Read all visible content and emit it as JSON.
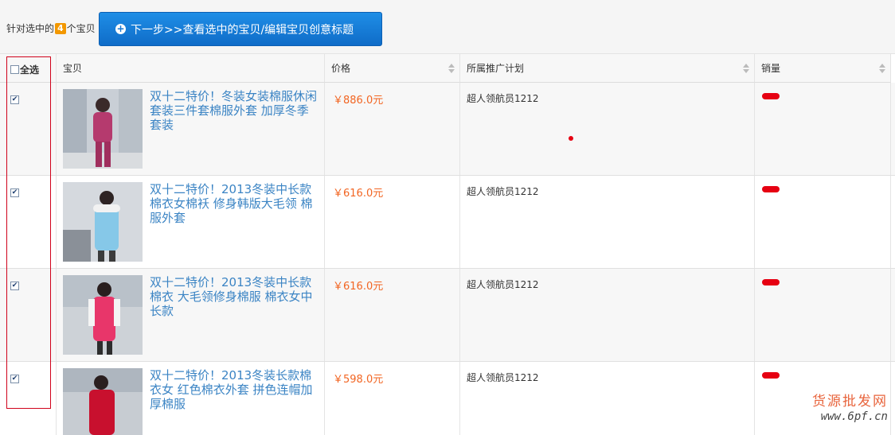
{
  "toolbar": {
    "selection_prefix": "针对选中的",
    "selection_count": "4",
    "selection_suffix": "个宝贝",
    "next_button_label": "下一步>>查看选中的宝贝/编辑宝贝创意标题"
  },
  "table": {
    "select_all_label": "全选",
    "columns": {
      "item": "宝贝",
      "price": "价格",
      "plan": "所属推广计划",
      "sales": "销量"
    },
    "rows": [
      {
        "checked": true,
        "title": "双十二特价！冬装女装棉服休闲套装三件套棉服外套 加厚冬季套装",
        "price": "￥886.0元",
        "plan": "超人领航员1212",
        "coat_color": "#b53a6e"
      },
      {
        "checked": true,
        "title": "双十二特价！2013冬装中长款棉衣女棉袄 修身韩版大毛领 棉服外套",
        "price": "￥616.0元",
        "plan": "超人领航员1212",
        "coat_color": "#86c8e8"
      },
      {
        "checked": true,
        "title": "双十二特价！2013冬装中长款棉衣 大毛领修身棉服 棉衣女中长款",
        "price": "￥616.0元",
        "plan": "超人领航员1212",
        "coat_color": "#e8366a"
      },
      {
        "checked": true,
        "title": "双十二特价！2013冬装长款棉衣女 红色棉衣外套 拼色连帽加厚棉服",
        "price": "￥598.0元",
        "plan": "超人领航员1212",
        "coat_color": "#c8102e"
      }
    ]
  },
  "watermark": {
    "line1": "货源批发网",
    "line2": "www.6pf.cn"
  },
  "colors": {
    "accent_blue": "#1677d2",
    "price_orange": "#f26522",
    "link_blue": "#3b84c4",
    "highlight_red": "#d0021b"
  }
}
